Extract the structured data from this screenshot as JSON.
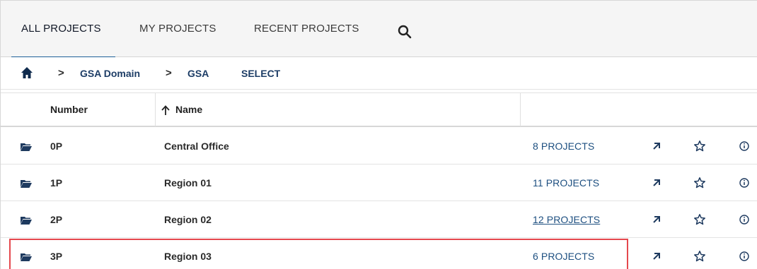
{
  "tabs": [
    {
      "label": "ALL PROJECTS",
      "active": true
    },
    {
      "label": "MY PROJECTS",
      "active": false
    },
    {
      "label": "RECENT PROJECTS",
      "active": false
    }
  ],
  "breadcrumb": {
    "items": [
      "GSA Domain",
      "GSA"
    ],
    "separator": ">",
    "action": "SELECT"
  },
  "table": {
    "columns": {
      "number": "Number",
      "name": "Name",
      "sort": "ascending"
    },
    "rows": [
      {
        "number": "0P",
        "name": "Central Office",
        "projects": "8 PROJECTS"
      },
      {
        "number": "1P",
        "name": "Region 01",
        "projects": "11 PROJECTS"
      },
      {
        "number": "2P",
        "name": "Region 02",
        "projects": "12 PROJECTS"
      },
      {
        "number": "3P",
        "name": "Region 03",
        "projects": "6 PROJECTS"
      }
    ]
  },
  "colors": {
    "accent": "#1f5f99",
    "link": "#1d4f80",
    "highlight": "#e5484d"
  },
  "icons": [
    "search-icon",
    "home-icon",
    "sort-arrow-up-icon",
    "folder-icon",
    "open-arrow-icon",
    "star-icon",
    "info-icon"
  ]
}
